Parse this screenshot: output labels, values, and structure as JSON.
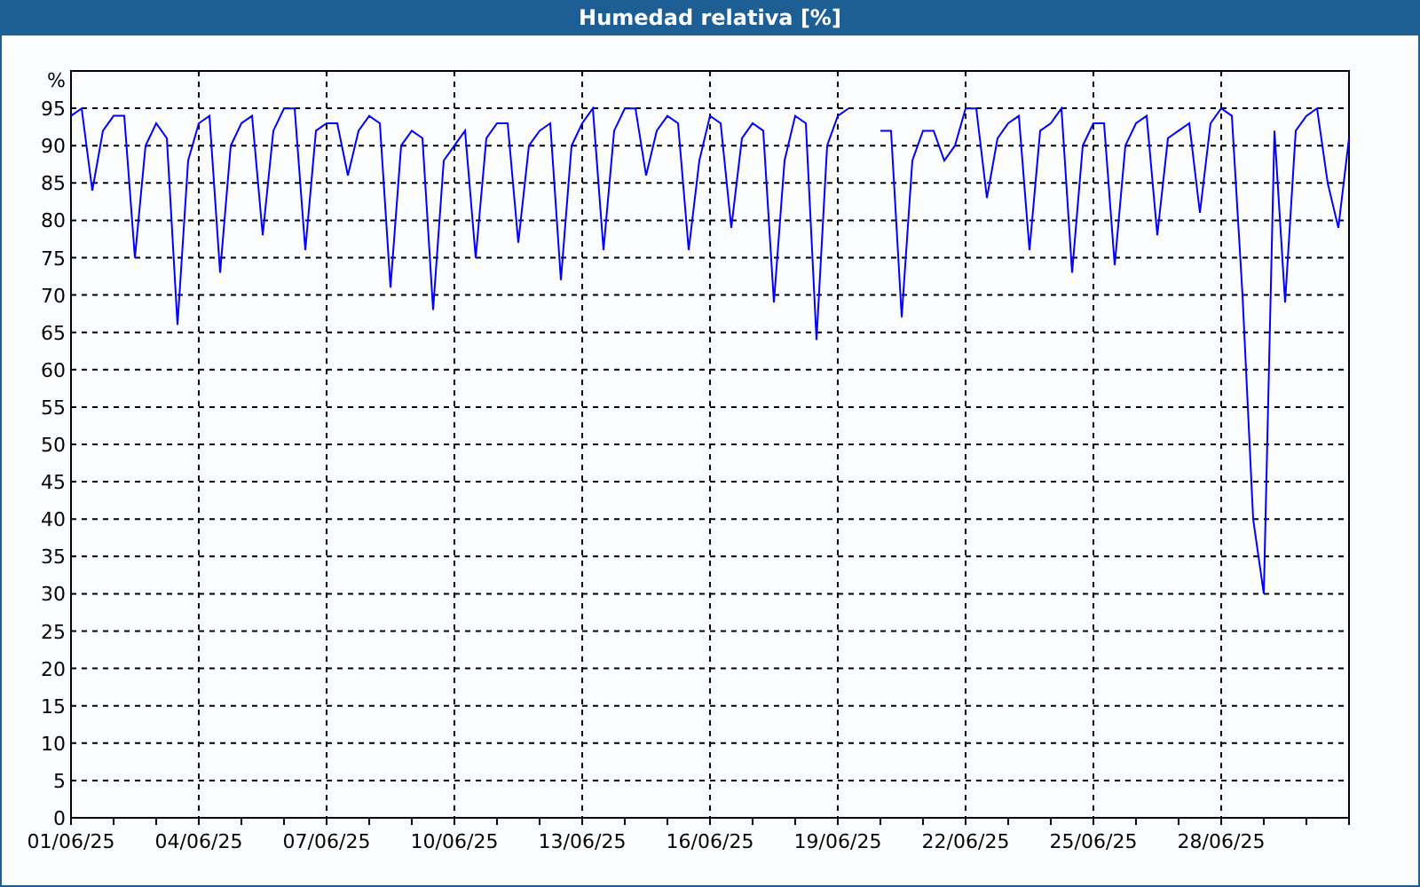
{
  "window": {
    "title": "Humedad relativa [%]"
  },
  "chart": {
    "chart_data": {
      "type": "line",
      "ylabel": "%",
      "categories": [
        "01/06/25",
        null,
        null,
        null,
        null,
        null,
        null,
        null,
        null,
        null,
        null,
        null,
        "04/06/25",
        null,
        null,
        null,
        null,
        null,
        null,
        null,
        null,
        null,
        null,
        null,
        "07/06/25",
        null,
        null,
        null,
        null,
        null,
        null,
        null,
        null,
        null,
        null,
        null,
        "10/06/25",
        null,
        null,
        null,
        null,
        null,
        null,
        null,
        null,
        null,
        null,
        null,
        "13/06/25",
        null,
        null,
        null,
        null,
        null,
        null,
        null,
        null,
        null,
        null,
        null,
        "16/06/25",
        null,
        null,
        null,
        null,
        null,
        null,
        null,
        null,
        null,
        null,
        null,
        "19/06/25",
        null,
        null,
        null,
        null,
        null,
        null,
        null,
        null,
        null,
        null,
        null,
        "22/06/25",
        null,
        null,
        null,
        null,
        null,
        null,
        null,
        null,
        null,
        null,
        null,
        "25/06/25",
        null,
        null,
        null,
        null,
        null,
        null,
        null,
        null,
        null,
        null,
        null,
        "28/06/25",
        null,
        null,
        null,
        null,
        null,
        null,
        null,
        null,
        null,
        null,
        null,
        null
      ],
      "series": [
        {
          "color": "#0000ff",
          "values": [
            94,
            95,
            84,
            92,
            94,
            94,
            75,
            90,
            93,
            91,
            66,
            88,
            93,
            94,
            73,
            90,
            93,
            94,
            78,
            92,
            95,
            95,
            76,
            92,
            93,
            93,
            86,
            92,
            94,
            93,
            71,
            90,
            92,
            91,
            68,
            88,
            90,
            92,
            75,
            91,
            93,
            93,
            77,
            90,
            92,
            93,
            72,
            90,
            93,
            95,
            76,
            92,
            95,
            95,
            86,
            92,
            94,
            93,
            76,
            88,
            94,
            93,
            79,
            91,
            93,
            92,
            69,
            88,
            94,
            93,
            64,
            90,
            94,
            95,
            null,
            null,
            92,
            92,
            67,
            88,
            92,
            92,
            88,
            90,
            95,
            95,
            83,
            91,
            93,
            94,
            76,
            92,
            93,
            95,
            73,
            90,
            93,
            93,
            74,
            90,
            93,
            94,
            78,
            91,
            92,
            93,
            81,
            93,
            95,
            94,
            70,
            40,
            30,
            92,
            69,
            92,
            94,
            95,
            85,
            79,
            91
          ]
        }
      ],
      "ylim": [
        0,
        100
      ],
      "grid": true,
      "yticks": [
        0,
        5,
        10,
        15,
        20,
        25,
        30,
        35,
        40,
        45,
        50,
        55,
        60,
        65,
        70,
        75,
        80,
        85,
        90,
        95
      ]
    }
  }
}
